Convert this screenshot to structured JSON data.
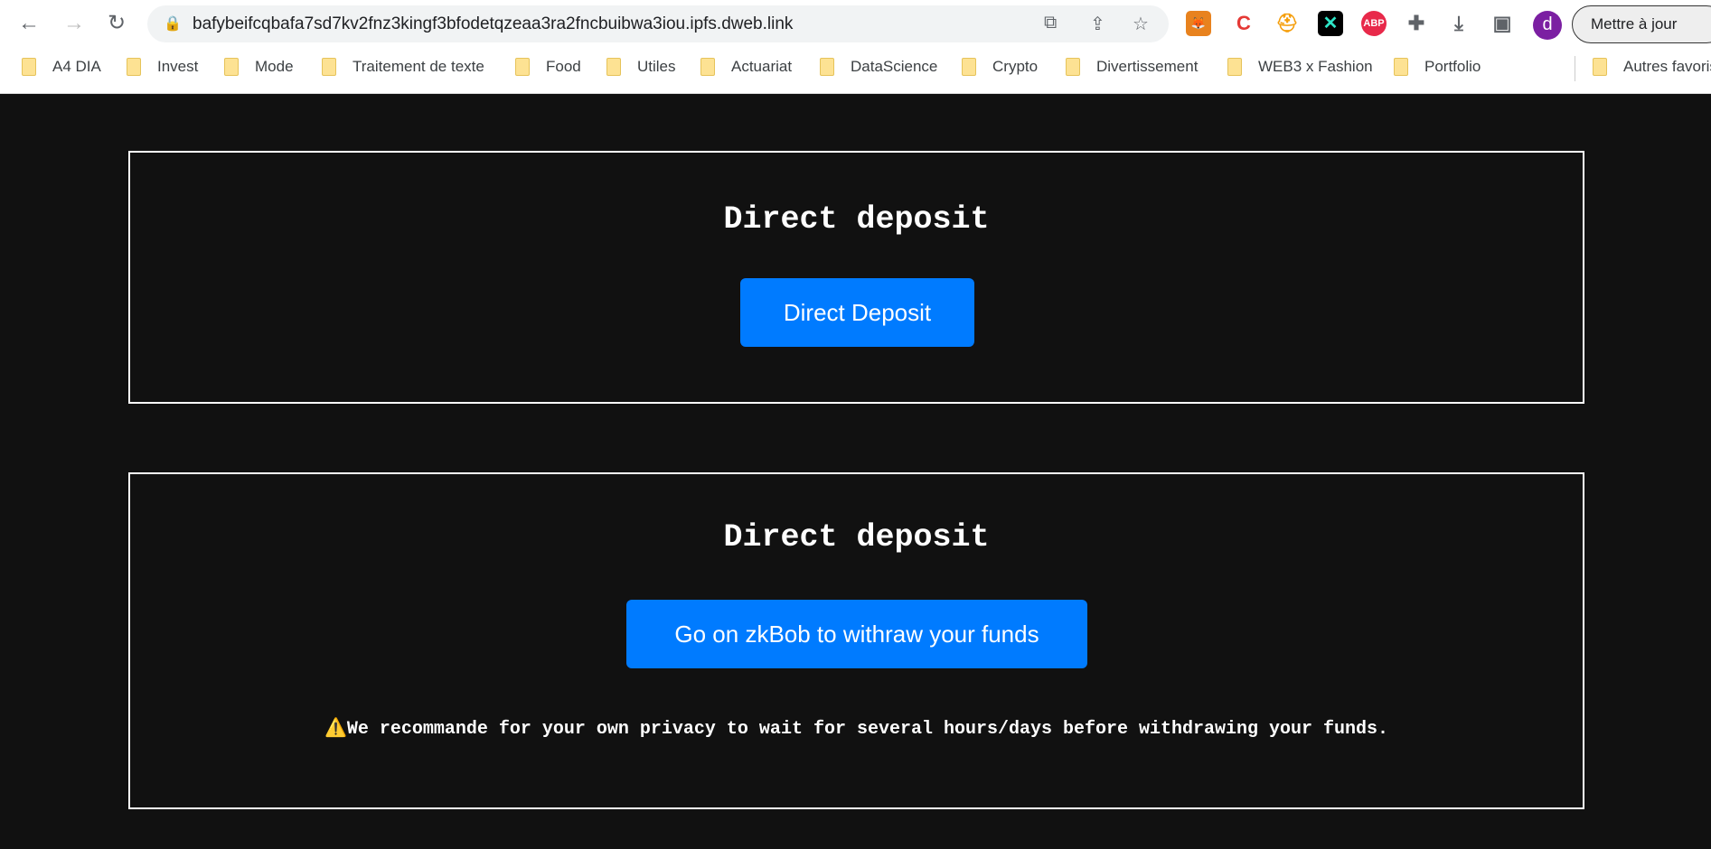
{
  "browser": {
    "url": "bafybeifcqbafa7sd7kv2fnz3kingf3bfodetqzeaa3ra2fncbuibwa3iou.ipfs.dweb.link",
    "avatar_letter": "d",
    "update_label": "Mettre à jour",
    "extensions": [
      "metamask",
      "c-extension",
      "helmet-extension",
      "x-extension",
      "ABP",
      "extensions-puzzle"
    ],
    "bookmarks": [
      "A4 DIA",
      "Invest",
      "Mode",
      "Traitement de texte",
      "Food",
      "Utiles",
      "Actuariat",
      "DataScience",
      "Crypto",
      "Divertissement",
      "WEB3 x Fashion",
      "Portfolio"
    ],
    "other_bookmarks": "Autres favoris"
  },
  "deposit_card": {
    "title": "Direct deposit",
    "button": "Direct Deposit"
  },
  "withdraw_card": {
    "title": "Direct deposit",
    "button": "Go on zkBob to withraw your funds",
    "warning_icon": "⚠️",
    "warning": "We recommande for your own privacy to wait for several hours/days before withdrawing your funds."
  },
  "colors": {
    "accent": "#007bff",
    "background": "#111111"
  }
}
